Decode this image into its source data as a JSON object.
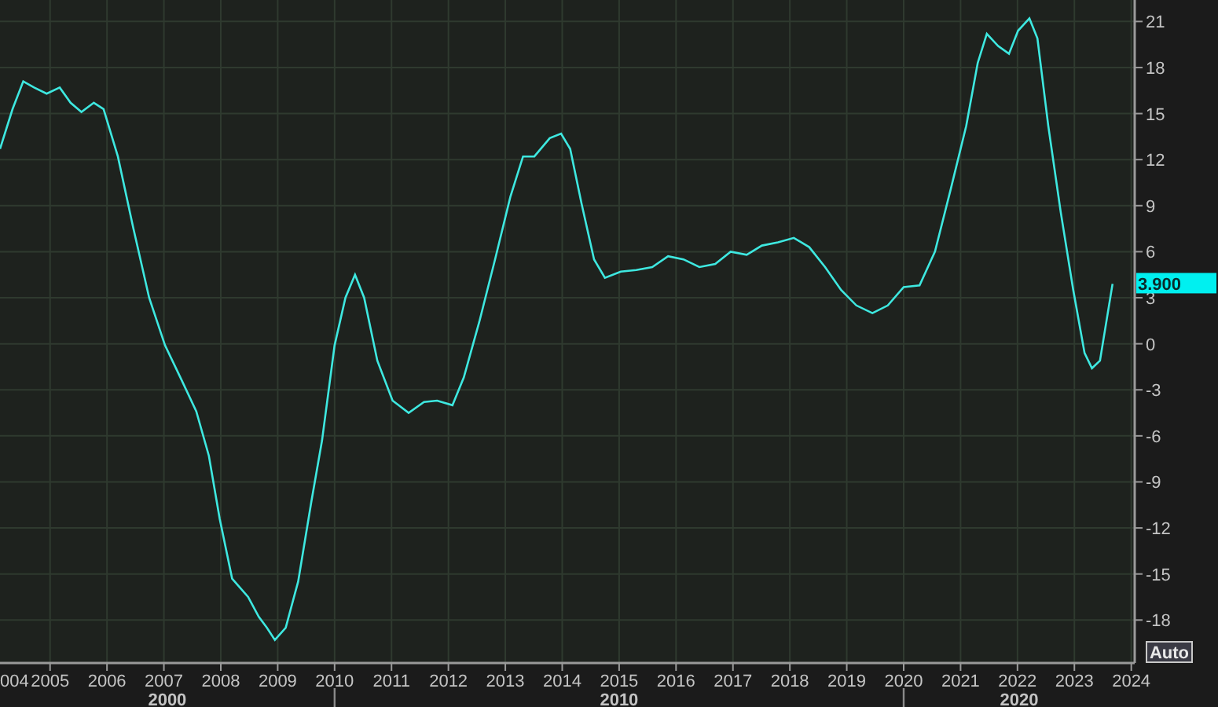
{
  "chart": {
    "chart_data": {
      "type": "line",
      "x": [
        2004.12,
        2004.34,
        2004.53,
        2004.72,
        2004.94,
        2005.17,
        2005.36,
        2005.55,
        2005.77,
        2005.94,
        2006.19,
        2006.46,
        2006.74,
        2007.02,
        2007.29,
        2007.57,
        2007.79,
        2007.98,
        2008.2,
        2008.48,
        2008.67,
        2008.81,
        2008.95,
        2009.14,
        2009.36,
        2009.59,
        2009.78,
        2010.0,
        2010.19,
        2010.36,
        2010.52,
        2010.75,
        2011.02,
        2011.3,
        2011.57,
        2011.8,
        2012.07,
        2012.27,
        2012.54,
        2012.82,
        2013.09,
        2013.31,
        2013.51,
        2013.78,
        2013.98,
        2014.14,
        2014.34,
        2014.56,
        2014.75,
        2015.03,
        2015.3,
        2015.58,
        2015.86,
        2016.13,
        2016.41,
        2016.69,
        2016.96,
        2017.24,
        2017.51,
        2017.79,
        2018.07,
        2018.34,
        2018.62,
        2018.9,
        2019.17,
        2019.45,
        2019.72,
        2020.0,
        2020.28,
        2020.55,
        2020.83,
        2021.1,
        2021.3,
        2021.46,
        2021.66,
        2021.85,
        2022.01,
        2022.21,
        2022.35,
        2022.54,
        2022.76,
        2022.98,
        2023.18,
        2023.31,
        2023.45,
        2023.67
      ],
      "series": [
        {
          "color": "#3ee8e0",
          "values": [
            12.7,
            15.3,
            17.1,
            16.7,
            16.3,
            16.7,
            15.7,
            15.1,
            15.7,
            15.3,
            12.2,
            7.6,
            3.0,
            -0.1,
            -2.2,
            -4.4,
            -7.3,
            -11.4,
            -15.3,
            -16.5,
            -17.8,
            -18.5,
            -19.3,
            -18.5,
            -15.5,
            -10.3,
            -6.3,
            -0.1,
            3.0,
            4.5,
            3.0,
            -1.1,
            -3.7,
            -4.5,
            -3.8,
            -3.7,
            -4.0,
            -2.2,
            1.4,
            5.5,
            9.6,
            12.2,
            12.2,
            13.4,
            13.7,
            12.7,
            9.1,
            5.5,
            4.3,
            4.7,
            4.8,
            5.0,
            5.7,
            5.5,
            5.0,
            5.2,
            6.0,
            5.8,
            6.4,
            6.6,
            6.9,
            6.3,
            5.0,
            3.5,
            2.5,
            2.0,
            2.5,
            3.7,
            3.8,
            6.0,
            10.1,
            14.2,
            18.3,
            20.2,
            19.4,
            18.9,
            20.4,
            21.2,
            19.9,
            14.2,
            8.6,
            3.5,
            -0.6,
            -1.6,
            -1.1,
            3.9
          ]
        }
      ],
      "xlim": [
        2004.12,
        2024.06
      ],
      "ylim": [
        -20.8,
        22.4
      ],
      "grid": true,
      "xticks": [
        2005,
        2006,
        2007,
        2008,
        2009,
        2010,
        2011,
        2012,
        2013,
        2014,
        2015,
        2016,
        2017,
        2018,
        2019,
        2020,
        2021,
        2022,
        2023,
        2024
      ],
      "yticks": [
        -18,
        -15,
        -12,
        -9,
        -6,
        -3,
        0,
        3,
        6,
        9,
        12,
        15,
        18,
        21
      ]
    },
    "cut_edge_tick_label": "004",
    "decade_labels": [
      "2000",
      "2010",
      "2020"
    ],
    "last_value_label": "3.900",
    "scale_button": {
      "label": "Auto"
    }
  }
}
